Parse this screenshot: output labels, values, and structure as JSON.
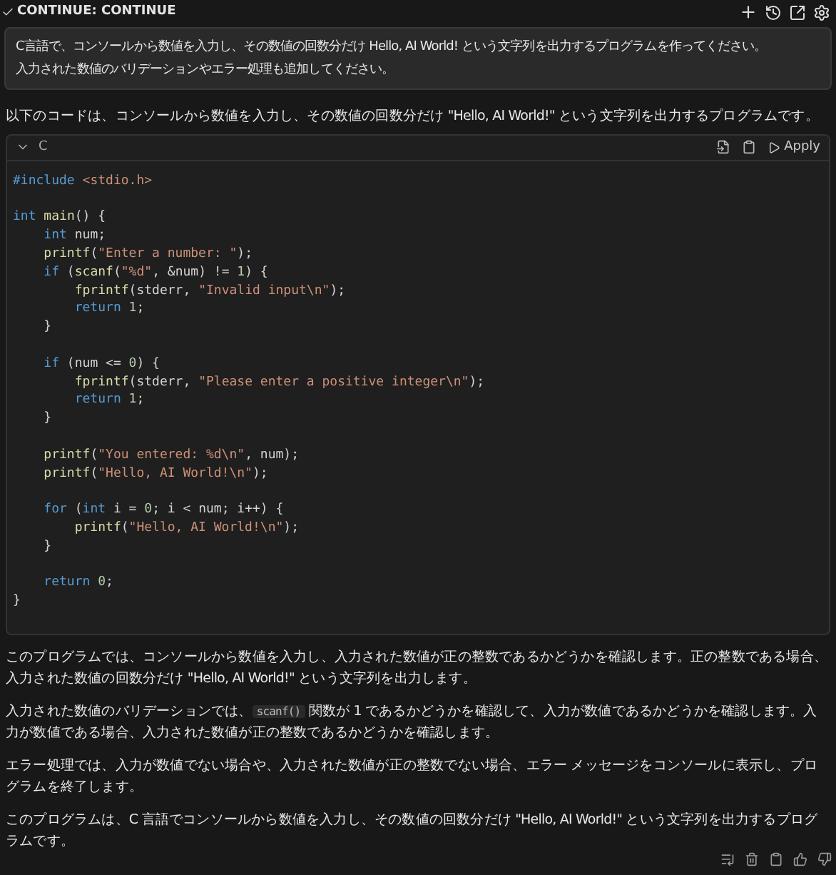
{
  "header": {
    "title": "CONTINUE: CONTINUE"
  },
  "user_message": {
    "lines": [
      "C言語で、コンソールから数値を入力し、その数値の回数分だけ Hello, AI World! という文字列を出力するプログラムを作ってください。",
      "入力された数値のバリデーションやエラー処理も追加してください。"
    ]
  },
  "intro": "以下のコードは、コンソールから数値を入力し、その数値の回数分だけ \"Hello, AI World!\" という文字列を出力するプログラムです。",
  "code_block": {
    "language": "C",
    "apply_label": "Apply",
    "sections": [
      {
        "lines": [
          [
            {
              "kind": "kw",
              "t": "#include"
            },
            {
              "kind": "str",
              "t": " <stdio.h>"
            }
          ]
        ]
      },
      {
        "lines": [
          [
            {
              "kind": "kw",
              "t": "int"
            },
            {
              "kind": "fn",
              "t": " main"
            },
            {
              "kind": "plain",
              "t": "() {"
            }
          ],
          [
            {
              "kind": "kw",
              "t": "    int"
            },
            {
              "kind": "plain",
              "t": " num;"
            }
          ],
          [
            {
              "kind": "fn",
              "t": "    printf"
            },
            {
              "kind": "plain",
              "t": "("
            },
            {
              "kind": "str",
              "t": "\"Enter a number: \""
            },
            {
              "kind": "plain",
              "t": ");"
            }
          ],
          [
            {
              "kind": "kw",
              "t": "    if"
            },
            {
              "kind": "plain",
              "t": " ("
            },
            {
              "kind": "fn",
              "t": "scanf"
            },
            {
              "kind": "plain",
              "t": "("
            },
            {
              "kind": "str",
              "t": "\"%d\""
            },
            {
              "kind": "plain",
              "t": ", &num) != "
            },
            {
              "kind": "num",
              "t": "1"
            },
            {
              "kind": "plain",
              "t": ") {"
            }
          ],
          [
            {
              "kind": "fn",
              "t": "        fprintf"
            },
            {
              "kind": "plain",
              "t": "(stderr, "
            },
            {
              "kind": "str",
              "t": "\"Invalid input\\n\""
            },
            {
              "kind": "plain",
              "t": ");"
            }
          ],
          [
            {
              "kind": "kw",
              "t": "        return"
            },
            {
              "kind": "num",
              "t": " 1"
            },
            {
              "kind": "plain",
              "t": ";"
            }
          ],
          [
            {
              "kind": "plain",
              "t": "    }"
            }
          ]
        ]
      },
      {
        "lines": [
          [
            {
              "kind": "kw",
              "t": "    if"
            },
            {
              "kind": "plain",
              "t": " (num <= "
            },
            {
              "kind": "num",
              "t": "0"
            },
            {
              "kind": "plain",
              "t": ") {"
            }
          ],
          [
            {
              "kind": "fn",
              "t": "        fprintf"
            },
            {
              "kind": "plain",
              "t": "(stderr, "
            },
            {
              "kind": "str",
              "t": "\"Please enter a positive integer\\n\""
            },
            {
              "kind": "plain",
              "t": ");"
            }
          ],
          [
            {
              "kind": "kw",
              "t": "        return"
            },
            {
              "kind": "num",
              "t": " 1"
            },
            {
              "kind": "plain",
              "t": ";"
            }
          ],
          [
            {
              "kind": "plain",
              "t": "    }"
            }
          ]
        ]
      },
      {
        "lines": [
          [
            {
              "kind": "fn",
              "t": "    printf"
            },
            {
              "kind": "plain",
              "t": "("
            },
            {
              "kind": "str",
              "t": "\"You entered: %d\\n\""
            },
            {
              "kind": "plain",
              "t": ", num);"
            }
          ],
          [
            {
              "kind": "fn",
              "t": "    printf"
            },
            {
              "kind": "plain",
              "t": "("
            },
            {
              "kind": "str",
              "t": "\"Hello, AI World!\\n\""
            },
            {
              "kind": "plain",
              "t": ");"
            }
          ]
        ]
      },
      {
        "lines": [
          [
            {
              "kind": "kw",
              "t": "    for"
            },
            {
              "kind": "plain",
              "t": " ("
            },
            {
              "kind": "kw",
              "t": "int"
            },
            {
              "kind": "plain",
              "t": " i = "
            },
            {
              "kind": "num",
              "t": "0"
            },
            {
              "kind": "plain",
              "t": "; i < num; i++) {"
            }
          ],
          [
            {
              "kind": "fn",
              "t": "        printf"
            },
            {
              "kind": "plain",
              "t": "("
            },
            {
              "kind": "str",
              "t": "\"Hello, AI World!\\n\""
            },
            {
              "kind": "plain",
              "t": ");"
            }
          ],
          [
            {
              "kind": "plain",
              "t": "    }"
            }
          ]
        ]
      },
      {
        "lines": [
          [
            {
              "kind": "kw",
              "t": "    return"
            },
            {
              "kind": "num",
              "t": " 0"
            },
            {
              "kind": "plain",
              "t": ";"
            }
          ],
          [
            {
              "kind": "plain",
              "t": "}"
            }
          ]
        ]
      }
    ]
  },
  "paragraphs": [
    [
      {
        "kind": "text",
        "t": "このプログラムでは、コンソールから数値を入力し、入力された数値が正の整数であるかどうかを確認します。正の整数である場合、入力された数値の回数分だけ \"Hello, AI World!\" という文字列を出力します。"
      }
    ],
    [
      {
        "kind": "text",
        "t": "入力された数値のバリデーションでは、"
      },
      {
        "kind": "code",
        "t": "scanf()"
      },
      {
        "kind": "text",
        "t": " 関数が 1 であるかどうかを確認して、入力が数値であるかどうかを確認します。入力が数値である場合、入力された数値が正の整数であるかどうかを確認します。"
      }
    ],
    [
      {
        "kind": "text",
        "t": "エラー処理では、入力が数値でない場合や、入力された数値が正の整数でない場合、エラー メッセージをコンソールに表示し、プログラムを終了します。"
      }
    ],
    [
      {
        "kind": "text",
        "t": "このプログラムは、C 言語でコンソールから数値を入力し、その数値の回数分だけ \"Hello, AI World!\" という文字列を出力するプログラムです。"
      }
    ]
  ]
}
